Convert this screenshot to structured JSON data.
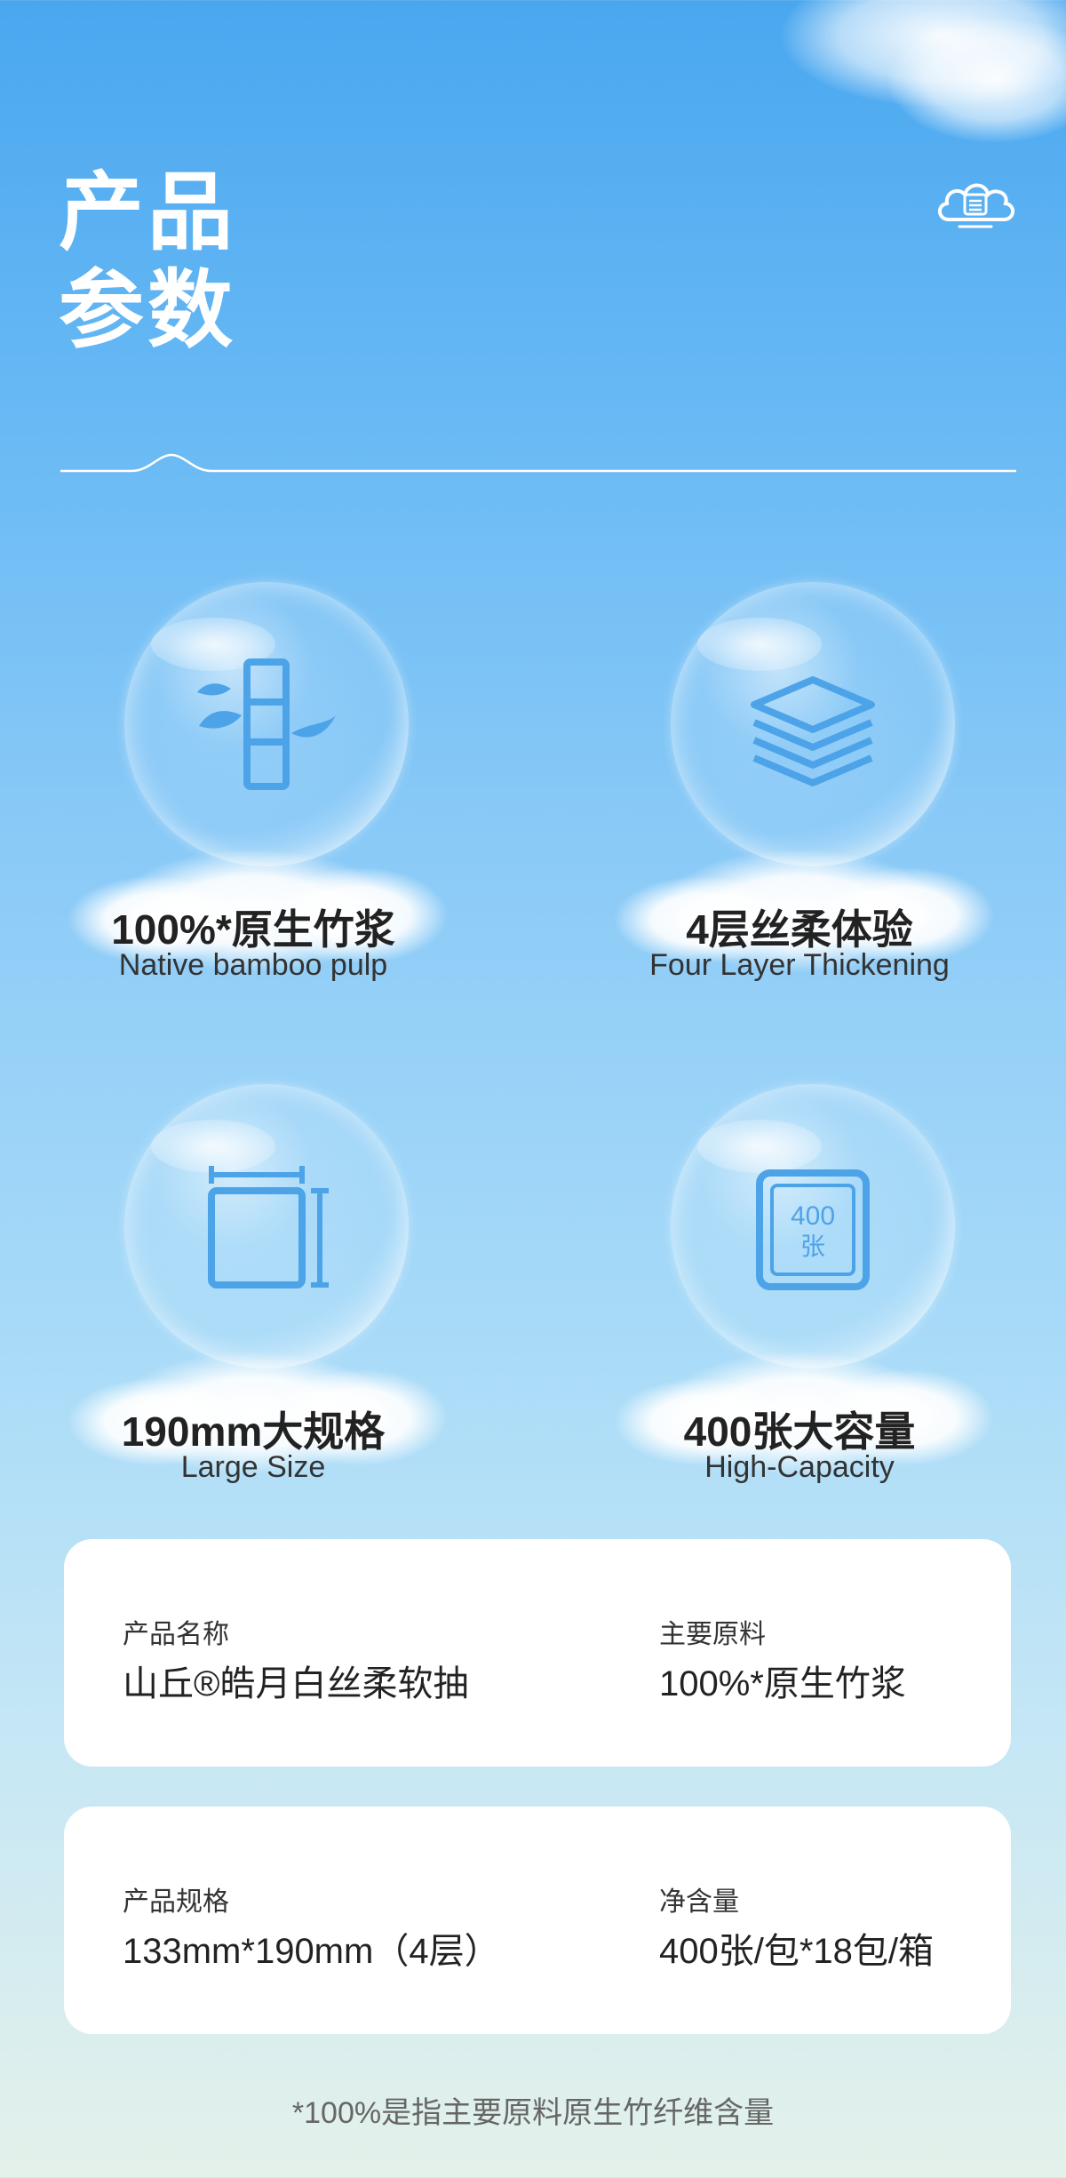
{
  "title_line1": "产品",
  "title_line2": "参数",
  "features": [
    {
      "title": "100%*原生竹浆",
      "subtitle": "Native bamboo pulp",
      "icon": "bamboo-icon"
    },
    {
      "title": "4层丝柔体验",
      "subtitle": "Four Layer Thickening",
      "icon": "layers-icon"
    },
    {
      "title": "190mm大规格",
      "subtitle": "Large Size",
      "icon": "size-frame-icon"
    },
    {
      "title": "400张大容量",
      "subtitle": "High-Capacity",
      "icon": "tissue-count-icon",
      "icon_text_1": "400",
      "icon_text_2": "张"
    }
  ],
  "cards": [
    {
      "left_label": "产品名称",
      "left_value": "山丘®皓月白丝柔软抽",
      "right_label": "主要原料",
      "right_value": "100%*原生竹浆"
    },
    {
      "left_label": "产品规格",
      "left_value": "133mm*190mm（4层）",
      "right_label": "净含量",
      "right_value": "400张/包*18包/箱"
    }
  ],
  "footnote": "*100%是指主要原料原生竹纤维含量",
  "colors": {
    "accent": "#4da3e8",
    "sky_top": "#4aa7ef",
    "sky_bottom": "#e4f1ea"
  }
}
